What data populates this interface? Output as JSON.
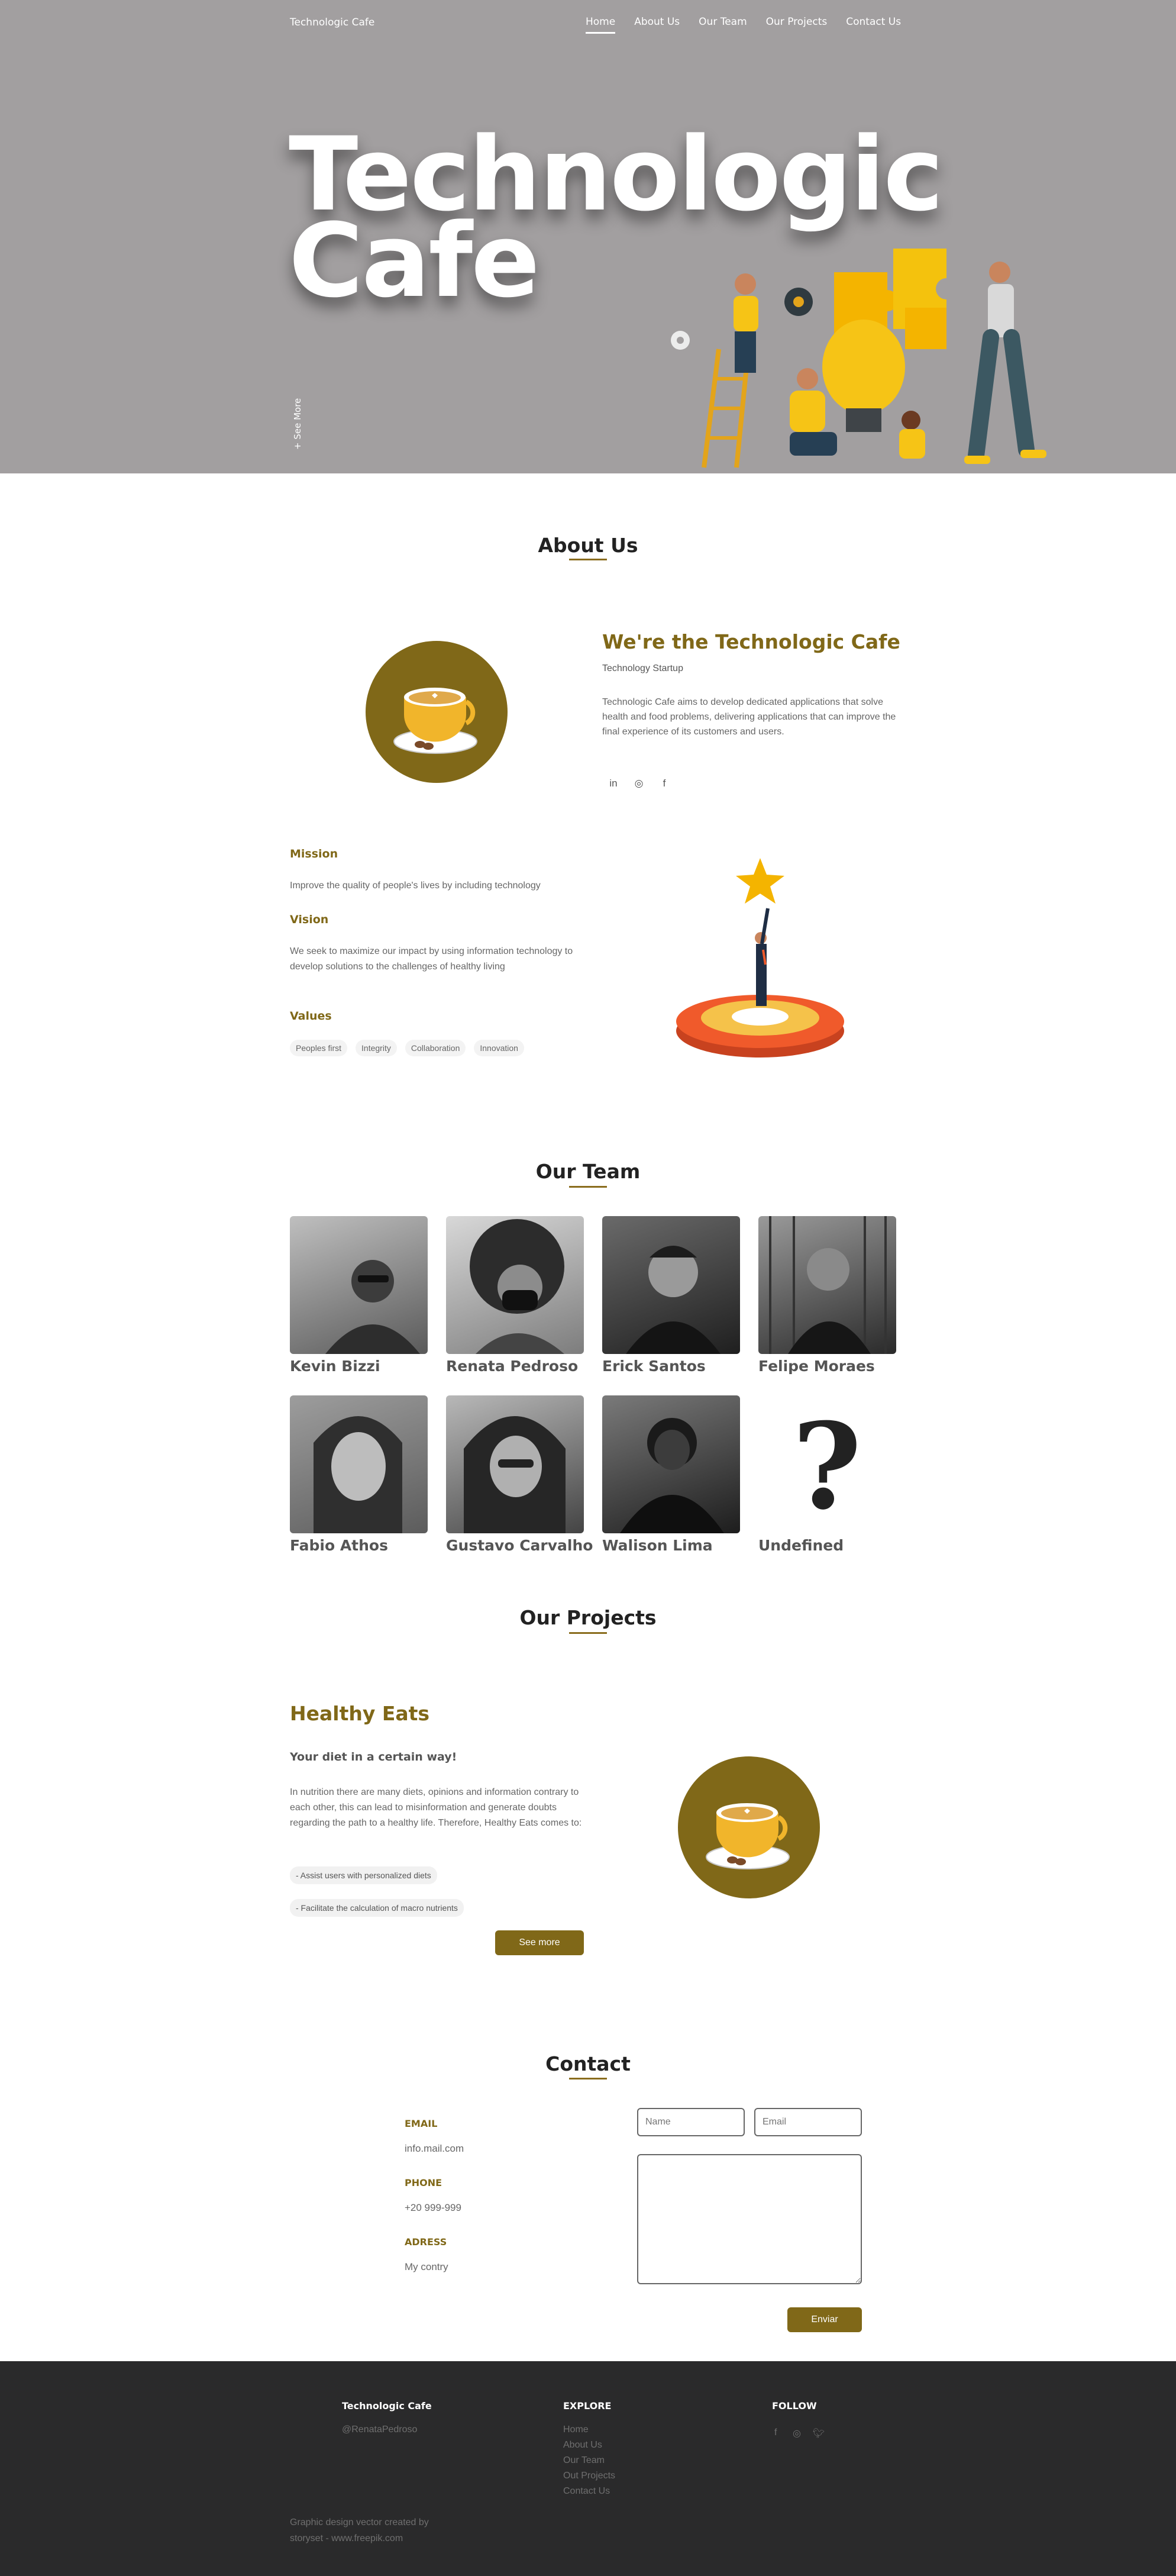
{
  "header": {
    "brand": "Technologic Cafe",
    "nav": [
      "Home",
      "About Us",
      "Our Team",
      "Our Projects",
      "Contact Us"
    ],
    "active_nav": "Home"
  },
  "hero": {
    "title_line1": "Technologic",
    "title_line2": "Cafe",
    "see_more": "+ See More"
  },
  "about": {
    "section_title": "About Us",
    "heading": "We're the Technologic Cafe",
    "subheading": "Technology Startup",
    "description": "Technologic Cafe aims to develop dedicated applications that solve health and food problems, delivering applications that can improve the final experience of its customers and users.",
    "social_icons": [
      "linkedin-icon",
      "instagram-icon",
      "facebook-icon"
    ],
    "mission_title": "Mission",
    "mission_text": "Improve the quality of people's lives by including technology",
    "vision_title": "Vision",
    "vision_text": "We seek to maximize our impact by using information technology to develop solutions to the challenges of healthy living",
    "values_title": "Values",
    "values": [
      "Peoples first",
      "Integrity",
      "Collaboration",
      "Innovation"
    ]
  },
  "team": {
    "section_title": "Our Team",
    "members": [
      "Kevin Bizzi",
      "Renata Pedroso",
      "Erick Santos",
      "Felipe Moraes",
      "Fabio Athos",
      "Gustavo Carvalho",
      "Walison Lima",
      "Undefined"
    ]
  },
  "projects": {
    "section_title": "Our Projects",
    "title": "Healthy Eats",
    "subtitle": "Your diet in a certain way!",
    "description": "In nutrition there are many diets, opinions and information contrary to each other, this can lead to misinformation and generate doubts regarding the path to a healthy life. Therefore, Healthy Eats comes to:",
    "features": [
      "- Assist users with personalized diets",
      "- Facilitate the calculation of macro nutrients"
    ],
    "button": "See more"
  },
  "contact": {
    "section_title": "Contact",
    "email_label": "EMAIL",
    "email_value": "info.mail.com",
    "phone_label": "PHONE",
    "phone_value": "+20 999-999",
    "address_label": "ADRESS",
    "address_value": "My contry",
    "name_placeholder": "Name",
    "email_placeholder": "Email",
    "send_button": "Enviar"
  },
  "footer": {
    "brand": "Technologic Cafe",
    "handle": "@RenataPedroso",
    "explore_title": "EXPLORE",
    "explore_links": [
      "Home",
      "About Us",
      "Our Team",
      "Out Projects",
      "Contact Us"
    ],
    "follow_title": "FOLLOW",
    "follow_icons": [
      "facebook-icon",
      "instagram-icon",
      "twitter-icon"
    ],
    "credit_line1": "Graphic design vector created by",
    "credit_line2": "storyset - www.freepik.com"
  },
  "colors": {
    "accent": "#806818",
    "hero_bg": "#a29fa0",
    "footer_bg": "#2a2a2b"
  }
}
